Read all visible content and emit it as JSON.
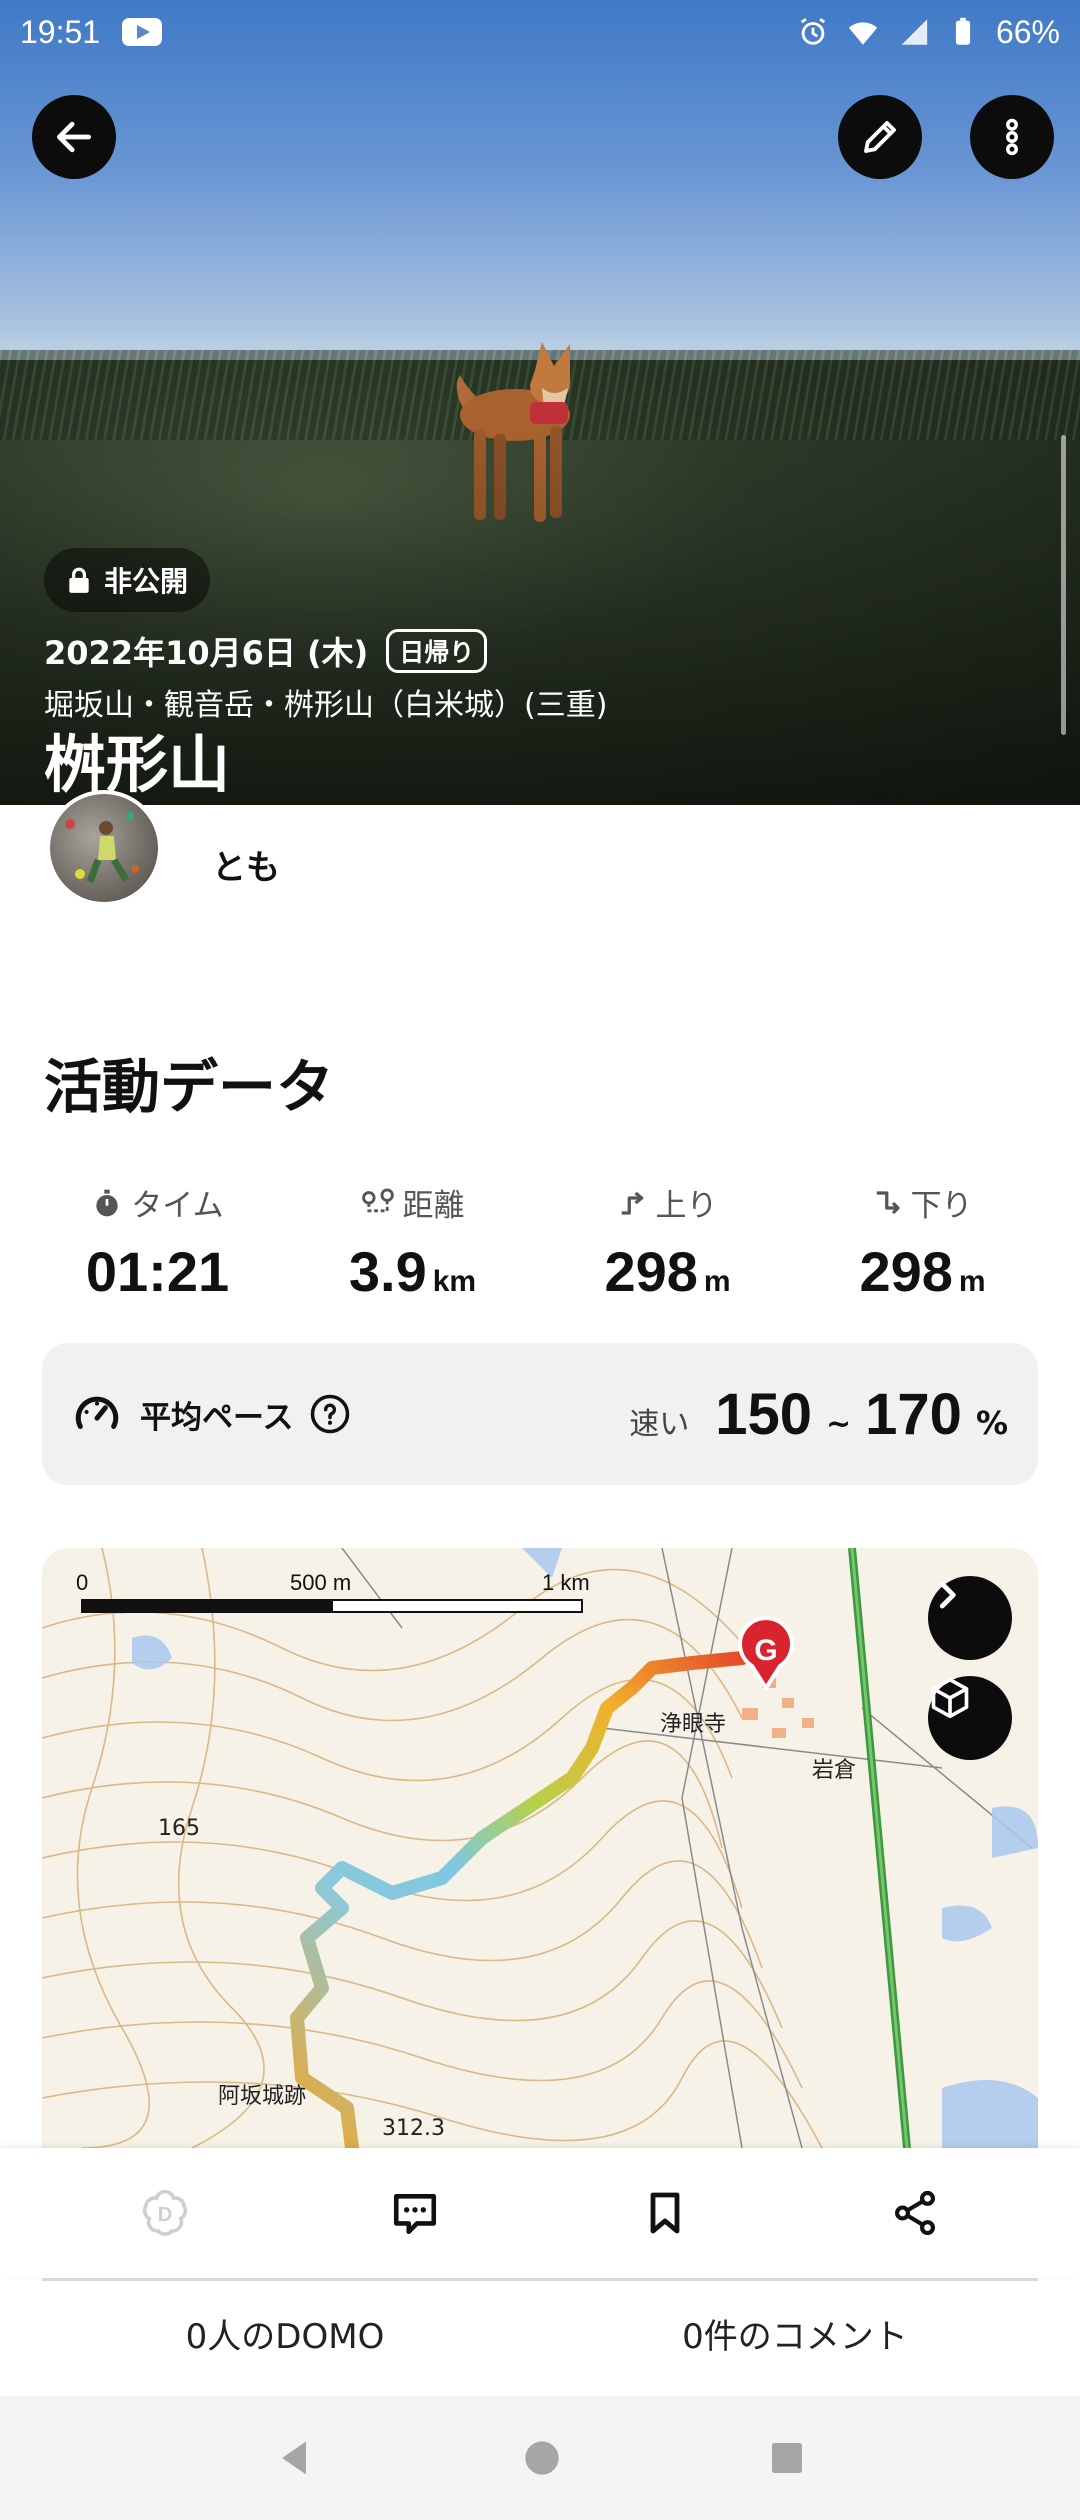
{
  "status_bar": {
    "time": "19:51",
    "battery": "66%"
  },
  "hero": {
    "private_label": "非公開",
    "date": "2022年10月6日 (木)",
    "trip_type": "日帰り",
    "area": "堀坂山・観音岳・桝形山（白米城）(三重)",
    "title": "桝形山"
  },
  "user": {
    "name": "とも"
  },
  "activity": {
    "title": "活動データ",
    "stats": [
      {
        "label": "タイム",
        "value": "01:21",
        "unit": ""
      },
      {
        "label": "距離",
        "value": "3.9",
        "unit": "km"
      },
      {
        "label": "上り",
        "value": "298",
        "unit": "m"
      },
      {
        "label": "下り",
        "value": "298",
        "unit": "m"
      }
    ],
    "pace": {
      "label": "平均ペース",
      "speed_label": "速い",
      "min": "150",
      "sep": "~",
      "max": "170",
      "unit": "%"
    }
  },
  "map": {
    "scale": [
      "0",
      "500 m",
      "1 km"
    ],
    "labels": {
      "temple": "浄眼寺",
      "iwakura": "岩倉",
      "elev": "165",
      "castle": "阿坂城跡",
      "peak": "312.3",
      "goal": "G"
    }
  },
  "footer": {
    "domo": "0人のDOMO",
    "comments": "0件のコメント"
  },
  "colors": {
    "accent": "#d9232e",
    "route_start": "#f4a623",
    "route_mid": "#7fc7e0",
    "route_end": "#e23a2a"
  }
}
